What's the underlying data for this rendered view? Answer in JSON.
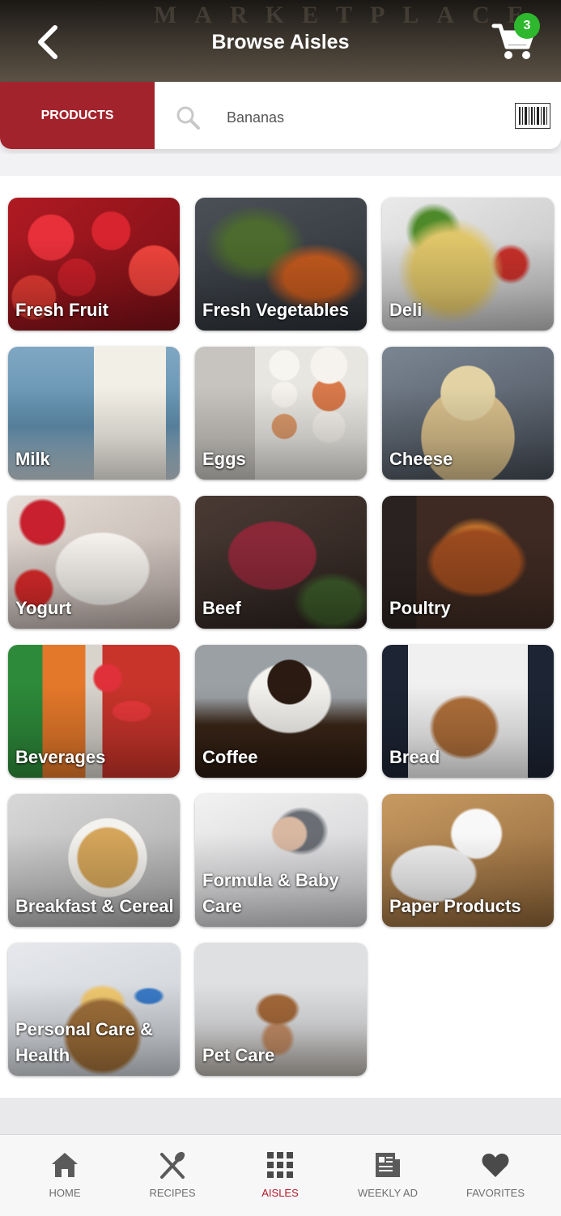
{
  "header": {
    "title": "Browse Aisles",
    "background_text": "MARKETPLACE",
    "cart_count": "3"
  },
  "search": {
    "tab_label": "PRODUCTS",
    "value": "Bananas",
    "placeholder": "Bananas"
  },
  "colors": {
    "accent": "#a3232c",
    "badge": "#2db82d",
    "active_nav": "#b3182a"
  },
  "aisles": [
    {
      "label": "Fresh Fruit",
      "icon": "strawberries-photo"
    },
    {
      "label": "Fresh Vegetables",
      "icon": "vegetables-photo"
    },
    {
      "label": "Deli",
      "icon": "pasta-salad-photo"
    },
    {
      "label": "Milk",
      "icon": "milk-glass-photo"
    },
    {
      "label": "Eggs",
      "icon": "eggs-carton-photo"
    },
    {
      "label": "Cheese",
      "icon": "cheese-wheels-photo"
    },
    {
      "label": "Yogurt",
      "icon": "yogurt-jar-photo"
    },
    {
      "label": "Beef",
      "icon": "raw-beef-photo"
    },
    {
      "label": "Poultry",
      "icon": "roast-turkey-photo"
    },
    {
      "label": "Beverages",
      "icon": "soda-bottles-photo"
    },
    {
      "label": "Coffee",
      "icon": "coffee-mug-photo"
    },
    {
      "label": "Bread",
      "icon": "bread-loaf-photo"
    },
    {
      "label": "Breakfast & Cereal",
      "icon": "cereal-bowl-photo"
    },
    {
      "label": "Formula & Baby Care",
      "icon": "sleeping-baby-photo"
    },
    {
      "label": "Paper Products",
      "icon": "paper-towel-photo"
    },
    {
      "label": "Personal Care & Health",
      "icon": "toiletries-basket-photo"
    },
    {
      "label": "Pet Care",
      "icon": "puppy-photo"
    }
  ],
  "nav": {
    "home": "HOME",
    "recipes": "RECIPES",
    "aisles": "AISLES",
    "weekly_ad": "WEEKLY AD",
    "favorites": "FAVORITES",
    "active": "AISLES"
  }
}
